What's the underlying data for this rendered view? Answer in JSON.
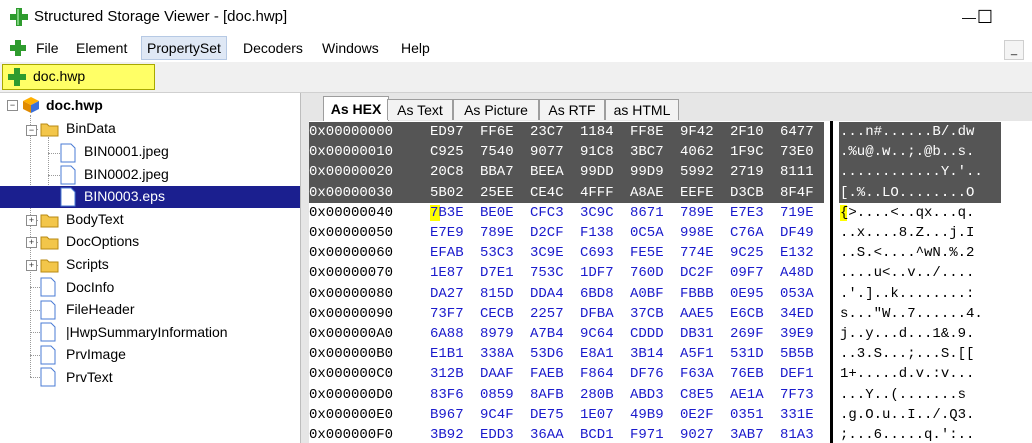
{
  "window": {
    "title": "Structured Storage Viewer - [doc.hwp]",
    "minimize": "—",
    "maximize": "☐"
  },
  "menu": {
    "items": [
      "File",
      "Element",
      "PropertySet",
      "Decoders",
      "Windows",
      "Help"
    ],
    "active": 2,
    "mdi_minimize": "_"
  },
  "document_tab": {
    "label": "doc.hwp"
  },
  "tree": {
    "root": "doc.hwp",
    "nodes": [
      {
        "label": "BinData",
        "type": "folder",
        "level": 1,
        "expanded": true
      },
      {
        "label": "BIN0001.jpeg",
        "type": "file",
        "level": 2
      },
      {
        "label": "BIN0002.jpeg",
        "type": "file",
        "level": 2
      },
      {
        "label": "BIN0003.eps",
        "type": "file",
        "level": 2,
        "selected": true
      },
      {
        "label": "BodyText",
        "type": "folder",
        "level": 1,
        "expanded": false
      },
      {
        "label": "DocOptions",
        "type": "folder",
        "level": 1,
        "expanded": false
      },
      {
        "label": "Scripts",
        "type": "folder",
        "level": 1,
        "expanded": false
      },
      {
        "label": "DocInfo",
        "type": "file",
        "level": 1
      },
      {
        "label": "FileHeader",
        "type": "file",
        "level": 1
      },
      {
        "label": "|HwpSummaryInformation",
        "type": "file",
        "level": 1
      },
      {
        "label": "PrvImage",
        "type": "file",
        "level": 1
      },
      {
        "label": "PrvText",
        "type": "file",
        "level": 1
      }
    ]
  },
  "viewer_tabs": [
    "As HEX",
    "As Text",
    "As Picture",
    "As RTF",
    "as HTML"
  ],
  "active_viewer_tab": 0,
  "hex": {
    "selected_rows": 4,
    "rows": [
      {
        "offset": "0x00000000",
        "words": [
          "ED97",
          "FF6E",
          "23C7",
          "1184",
          "FF8E",
          "9F42",
          "2F10",
          "6477"
        ],
        "ascii": "...n#......B/.dw"
      },
      {
        "offset": "0x00000010",
        "words": [
          "C925",
          "7540",
          "9077",
          "91C8",
          "3BC7",
          "4062",
          "1F9C",
          "73E0"
        ],
        "ascii": ".%u@.w..;.@b..s."
      },
      {
        "offset": "0x00000020",
        "words": [
          "20C8",
          "BBA7",
          "BEEA",
          "99DD",
          "99D9",
          "5992",
          "2719",
          "8111"
        ],
        "ascii": "............Y.'.."
      },
      {
        "offset": "0x00000030",
        "words": [
          "5B02",
          "25EE",
          "CE4C",
          "4FFF",
          "A8AE",
          "EEFE",
          "D3CB",
          "8F4F"
        ],
        "ascii": "[.%..LO........O"
      },
      {
        "offset": "0x00000040",
        "words": [
          "7B3E",
          "BE0E",
          "CFC3",
          "3C9C",
          "8671",
          "789E",
          "E7E3",
          "719E"
        ],
        "ascii": "{>....<..qx...q."
      },
      {
        "offset": "0x00000050",
        "words": [
          "E7E9",
          "789E",
          "D2CF",
          "F138",
          "0C5A",
          "998E",
          "C76A",
          "DF49"
        ],
        "ascii": "..x....8.Z...j.I"
      },
      {
        "offset": "0x00000060",
        "words": [
          "EFAB",
          "53C3",
          "3C9E",
          "C693",
          "FE5E",
          "774E",
          "9C25",
          "E132"
        ],
        "ascii": "..S.<....^wN.%.2"
      },
      {
        "offset": "0x00000070",
        "words": [
          "1E87",
          "D7E1",
          "753C",
          "1DF7",
          "760D",
          "DC2F",
          "09F7",
          "A48D"
        ],
        "ascii": "....u<..v../...."
      },
      {
        "offset": "0x00000080",
        "words": [
          "DA27",
          "815D",
          "DDA4",
          "6BD8",
          "A0BF",
          "FBBB",
          "0E95",
          "053A"
        ],
        "ascii": ".'.]..k........:"
      },
      {
        "offset": "0x00000090",
        "words": [
          "73F7",
          "CECB",
          "2257",
          "DFBA",
          "37CB",
          "AAE5",
          "E6CB",
          "34ED"
        ],
        "ascii": "s...\"W..7......4."
      },
      {
        "offset": "0x000000A0",
        "words": [
          "6A88",
          "8979",
          "A7B4",
          "9C64",
          "CDDD",
          "DB31",
          "269F",
          "39E9"
        ],
        "ascii": "j..y...d...1&.9."
      },
      {
        "offset": "0x000000B0",
        "words": [
          "E1B1",
          "338A",
          "53D6",
          "E8A1",
          "3B14",
          "A5F1",
          "531D",
          "5B5B"
        ],
        "ascii": "..3.S...;...S.[["
      },
      {
        "offset": "0x000000C0",
        "words": [
          "312B",
          "DAAF",
          "FAEB",
          "F864",
          "DF76",
          "F63A",
          "76EB",
          "DEF1"
        ],
        "ascii": "1+.....d.v.:v..."
      },
      {
        "offset": "0x000000D0",
        "words": [
          "83F6",
          "0859",
          "8AFB",
          "280B",
          "ABD3",
          "C8E5",
          "AE1A",
          "7F73"
        ],
        "ascii": "...Y..(.......s"
      },
      {
        "offset": "0x000000E0",
        "words": [
          "B967",
          "9C4F",
          "DE75",
          "1E07",
          "49B9",
          "0E2F",
          "0351",
          "331E"
        ],
        "ascii": ".g.O.u..I../.Q3."
      },
      {
        "offset": "0x000000F0",
        "words": [
          "3B92",
          "EDD3",
          "36AA",
          "BCD1",
          "F971",
          "9027",
          "3AB7",
          "81A3"
        ],
        "ascii": ";...6.....q.':.."
      }
    ]
  },
  "colors": {
    "hex_text": "#1a1acc",
    "selection": "#555555",
    "tree_selection": "#1b1f8f",
    "doc_tab": "#ffff66",
    "cursor": "#ffff00"
  }
}
